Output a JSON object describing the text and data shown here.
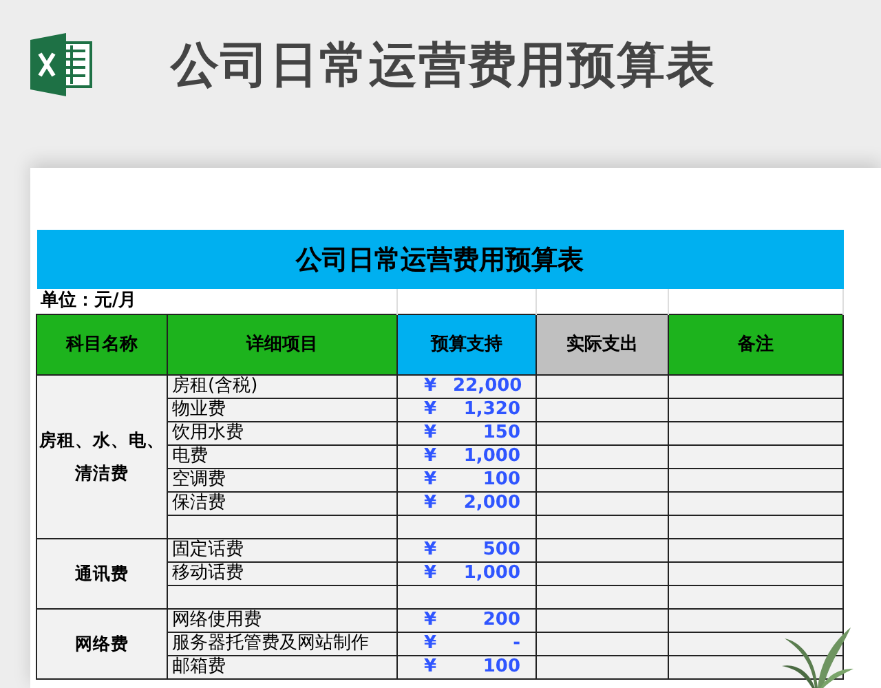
{
  "header": {
    "title": "公司日常运营费用预算表"
  },
  "sheet": {
    "title": "公司日常运营费用预算表",
    "unit": "单位：元/月",
    "columns": [
      {
        "label": "科目名称",
        "color": "#1db31d"
      },
      {
        "label": "详细项目",
        "color": "#1db31d"
      },
      {
        "label": "预算支持",
        "color": "#00b0f0"
      },
      {
        "label": "实际支出",
        "color": "#c0c0c0"
      },
      {
        "label": "备注",
        "color": "#1db31d"
      }
    ],
    "groups": [
      {
        "name": "房租、水、电、清洁费",
        "rows": [
          {
            "kind": "item",
            "item": "房租(含税)",
            "currency": "¥",
            "amount": "22,000"
          },
          {
            "kind": "item",
            "item": "物业费",
            "currency": "¥",
            "amount": "1,320"
          },
          {
            "kind": "item",
            "item": "饮用水费",
            "currency": "¥",
            "amount": "150"
          },
          {
            "kind": "item",
            "item": "电费",
            "currency": "¥",
            "amount": "1,000"
          },
          {
            "kind": "item",
            "item": "空调费",
            "currency": "¥",
            "amount": "100"
          },
          {
            "kind": "item",
            "item": "保洁费",
            "currency": "¥",
            "amount": "2,000"
          },
          {
            "kind": "blank"
          }
        ]
      },
      {
        "name": "通讯费",
        "rows": [
          {
            "kind": "item",
            "item": "固定话费",
            "currency": "¥",
            "amount": "500"
          },
          {
            "kind": "item",
            "item": "移动话费",
            "currency": "¥",
            "amount": "1,000"
          },
          {
            "kind": "blank"
          }
        ]
      },
      {
        "name": "网络费",
        "rows": [
          {
            "kind": "item",
            "item": "网络使用费",
            "currency": "¥",
            "amount": "200"
          },
          {
            "kind": "item",
            "item": "服务器托管费及网站制作",
            "currency": "¥",
            "amount": "-"
          },
          {
            "kind": "item",
            "item": "邮箱费",
            "currency": "¥",
            "amount": "100"
          }
        ]
      }
    ]
  }
}
